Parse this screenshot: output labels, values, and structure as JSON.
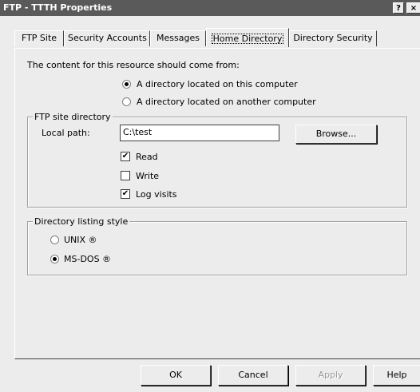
{
  "window": {
    "title": "FTP - TTTH Properties",
    "help_button": "?",
    "close_button": "×"
  },
  "tabs": [
    {
      "label": "FTP Site"
    },
    {
      "label": "Security Accounts"
    },
    {
      "label": "Messages"
    },
    {
      "label": "Home Directory",
      "active": true
    },
    {
      "label": "Directory Security"
    }
  ],
  "content_source": {
    "prompt": "The content for this resource should come from:",
    "option_local": "A directory located on this computer",
    "option_remote": "A directory located on another computer",
    "selected": "local"
  },
  "ftp_site_directory": {
    "group_title": "FTP site directory",
    "local_path_label": "Local path:",
    "local_path_value": "C:\\test",
    "browse_button": "Browse...",
    "read_label": "Read",
    "read_checked": true,
    "write_label": "Write",
    "write_checked": false,
    "log_visits_label": "Log visits",
    "log_visits_checked": true
  },
  "listing_style": {
    "group_title": "Directory listing style",
    "unix_label": "UNIX ®",
    "msdos_label": "MS-DOS ®",
    "selected": "msdos"
  },
  "footer": {
    "ok": "OK",
    "cancel": "Cancel",
    "apply": "Apply",
    "help": "Help"
  },
  "check_mark": "✔"
}
